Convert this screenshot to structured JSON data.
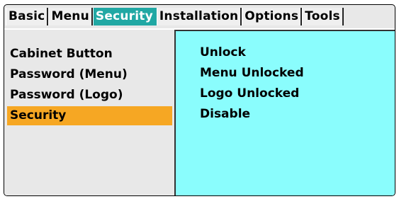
{
  "tabs": [
    {
      "label": "Basic",
      "active": false
    },
    {
      "label": "Menu",
      "active": false
    },
    {
      "label": "Security",
      "active": true
    },
    {
      "label": "Installation",
      "active": false
    },
    {
      "label": "Options",
      "active": false
    },
    {
      "label": "Tools",
      "active": false
    }
  ],
  "menu": {
    "items": [
      {
        "label": "Cabinet Button"
      },
      {
        "label": "Password (Menu)"
      },
      {
        "label": "Password (Logo)"
      },
      {
        "label": "Security"
      }
    ],
    "selected": "Security"
  },
  "options": {
    "items": [
      {
        "label": "Unlock"
      },
      {
        "label": "Menu Unlocked"
      },
      {
        "label": "Logo Unlocked"
      },
      {
        "label": "Disable"
      }
    ]
  },
  "colors": {
    "active_tab": "#21a8a4",
    "selected_item": "#f6a723",
    "option_panel": "#8afdfd",
    "background": "#e8e8e8"
  }
}
